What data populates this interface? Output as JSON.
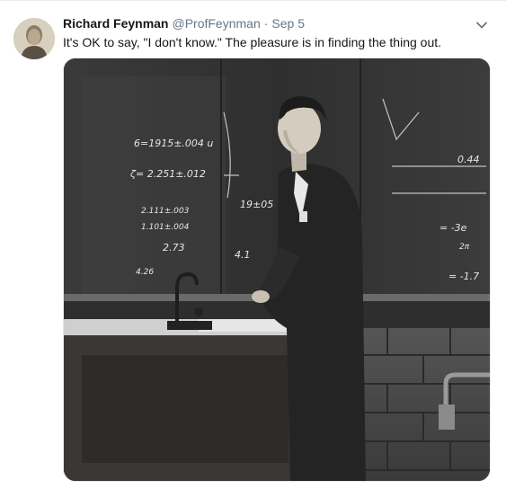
{
  "tweet": {
    "author_name": "Richard Feynman",
    "author_handle": "@ProfFeynman",
    "separator": "·",
    "timestamp": "Sep 5",
    "text": "It's OK to say, \"I don't know.\" The pleasure is in finding the thing out."
  },
  "media": {
    "chalk_formulas": [
      "6=1915±.004 u",
      "ζ= 2.251±.012",
      "2.111±.003",
      "1.101±.004",
      "2.73",
      "4.26",
      "19±05",
      "4.1",
      "0.44",
      "= -3e",
      "2π",
      "= -1.7"
    ]
  },
  "icons": {
    "caret": "chevron-down-icon"
  },
  "colors": {
    "name": "#14171a",
    "secondary": "#657786",
    "border": "#e1e8ed"
  }
}
